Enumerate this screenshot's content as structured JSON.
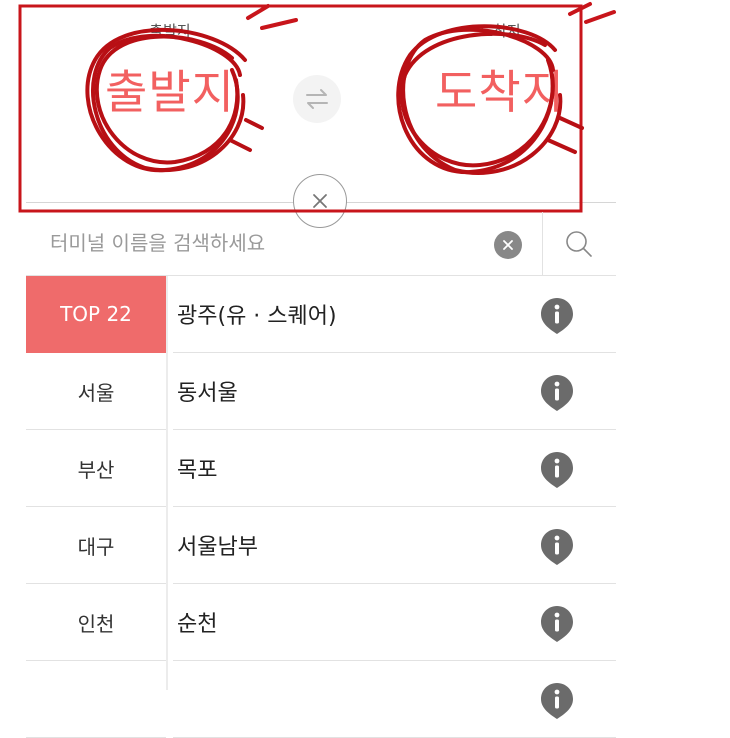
{
  "route": {
    "departure_small": "출발지",
    "departure_big": "출발지",
    "arrival_small": "도착지",
    "arrival_big": "도착지"
  },
  "search": {
    "placeholder": "터미널 이름을 검색하세요",
    "value": ""
  },
  "regions": [
    {
      "label": "TOP 22",
      "active": true
    },
    {
      "label": "서울",
      "active": false
    },
    {
      "label": "부산",
      "active": false
    },
    {
      "label": "대구",
      "active": false
    },
    {
      "label": "인천",
      "active": false
    },
    {
      "label": "",
      "active": false
    }
  ],
  "terminals": [
    {
      "name": "광주(유 · 스퀘어)"
    },
    {
      "name": "동서울"
    },
    {
      "name": "목포"
    },
    {
      "name": "서울남부"
    },
    {
      "name": "순천"
    },
    {
      "name": ""
    }
  ],
  "colors": {
    "accent": "#ef6b6b",
    "station_text": "#f26060",
    "annotation": "#b80f14",
    "info_icon": "#6b6b6b"
  },
  "icons": {
    "swap": "swap-arrows-icon",
    "close": "close-icon",
    "clear": "clear-circle-icon",
    "search": "search-icon",
    "info": "info-pin-icon"
  }
}
